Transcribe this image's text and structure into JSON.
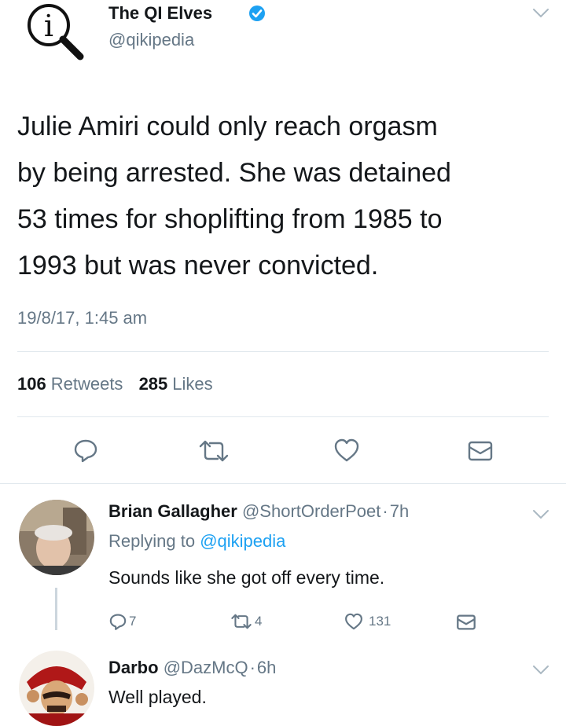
{
  "tweet": {
    "author_name": "The QI Elves",
    "handle": "@qikipedia",
    "text_lines": [
      "Julie Amiri could only reach orgasm",
      "by being arrested. She was detained",
      "53 times for shoplifting from 1985 to",
      "1993 but was never convicted."
    ],
    "timestamp": "19/8/17, 1:45 am",
    "retweets_count": "106",
    "retweets_label": "Retweets",
    "likes_count": "285",
    "likes_label": "Likes",
    "avatar_letter": "i"
  },
  "replies": [
    {
      "name": "Brian Gallagher",
      "handle": "@ShortOrderPoet",
      "sep": "·",
      "time": "7h",
      "replying_prefix": "Replying to",
      "replying_handle": "@qikipedia",
      "text": "Sounds like she got off every time.",
      "reply_count": "7",
      "retweet_count": "4",
      "like_count": "131"
    },
    {
      "name": "Darbo",
      "handle": "@DazMcQ",
      "sep": "·",
      "time": "6h",
      "text": "Well played."
    }
  ],
  "icons": {
    "verified": "verified-badge-icon",
    "chevron": "chevron-down-icon",
    "reply": "reply-icon",
    "retweet": "retweet-icon",
    "like": "heart-icon",
    "dm": "direct-message-icon"
  },
  "colors": {
    "accent": "#1da1f2",
    "muted": "#657786",
    "text": "#14171a",
    "divider": "#e1e8ed"
  }
}
